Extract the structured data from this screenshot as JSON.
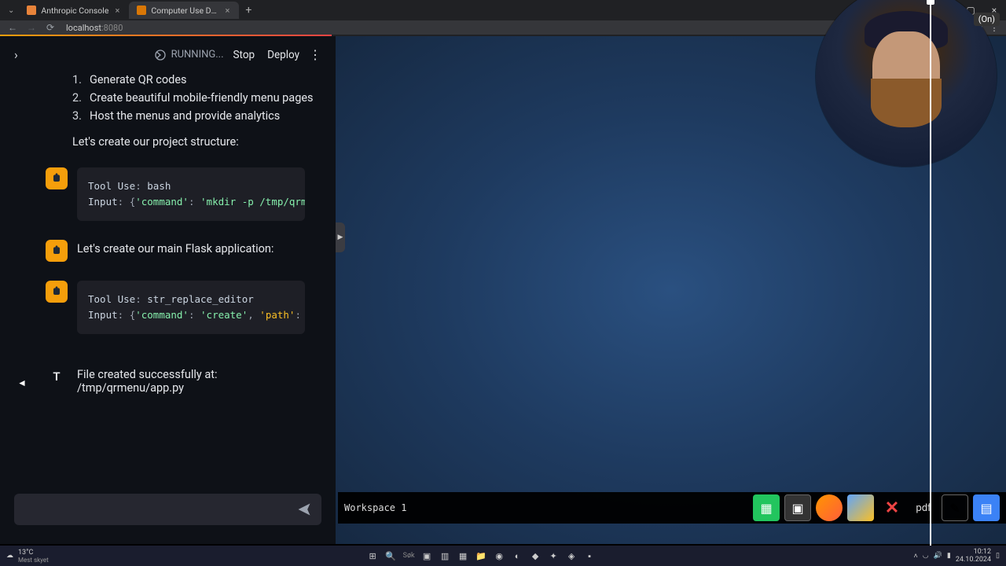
{
  "browser": {
    "tabs": [
      {
        "title": "Anthropic Console",
        "active": false
      },
      {
        "title": "Computer Use Demo",
        "active": true
      }
    ],
    "url_host": "localhost",
    "url_port": ":8080"
  },
  "header": {
    "status": "RUNNING...",
    "stop": "Stop",
    "deploy": "Deploy"
  },
  "list": {
    "items": [
      {
        "n": "1.",
        "text": "Generate QR codes"
      },
      {
        "n": "2.",
        "text": "Create beautiful mobile-friendly menu pages"
      },
      {
        "n": "3.",
        "text": "Host the menus and provide analytics"
      }
    ]
  },
  "prose1": "Let's create our project structure:",
  "code1": {
    "label": "Tool Use",
    "tool": "bash",
    "input_label": "Input",
    "key": "'command'",
    "val": "'mkdir -p /tmp/qrm"
  },
  "msg2": "Let's create our main Flask application:",
  "code2": {
    "label": "Tool Use",
    "tool": "str_replace_editor",
    "input_label": "Input",
    "key": "'command'",
    "val": "'create'",
    "key2": "'path'"
  },
  "result": {
    "marker": "T",
    "text": "File created successfully at: /tmp/qrmenu/app.py"
  },
  "badge": "(On)",
  "workspace": "Workspace 1",
  "dock_pdf": "pdf",
  "weather": {
    "temp": "13°C",
    "desc": "Mest skyet"
  },
  "search_placeholder": "Søk",
  "clock": {
    "time": "10:12",
    "date": "24.10.2024"
  }
}
